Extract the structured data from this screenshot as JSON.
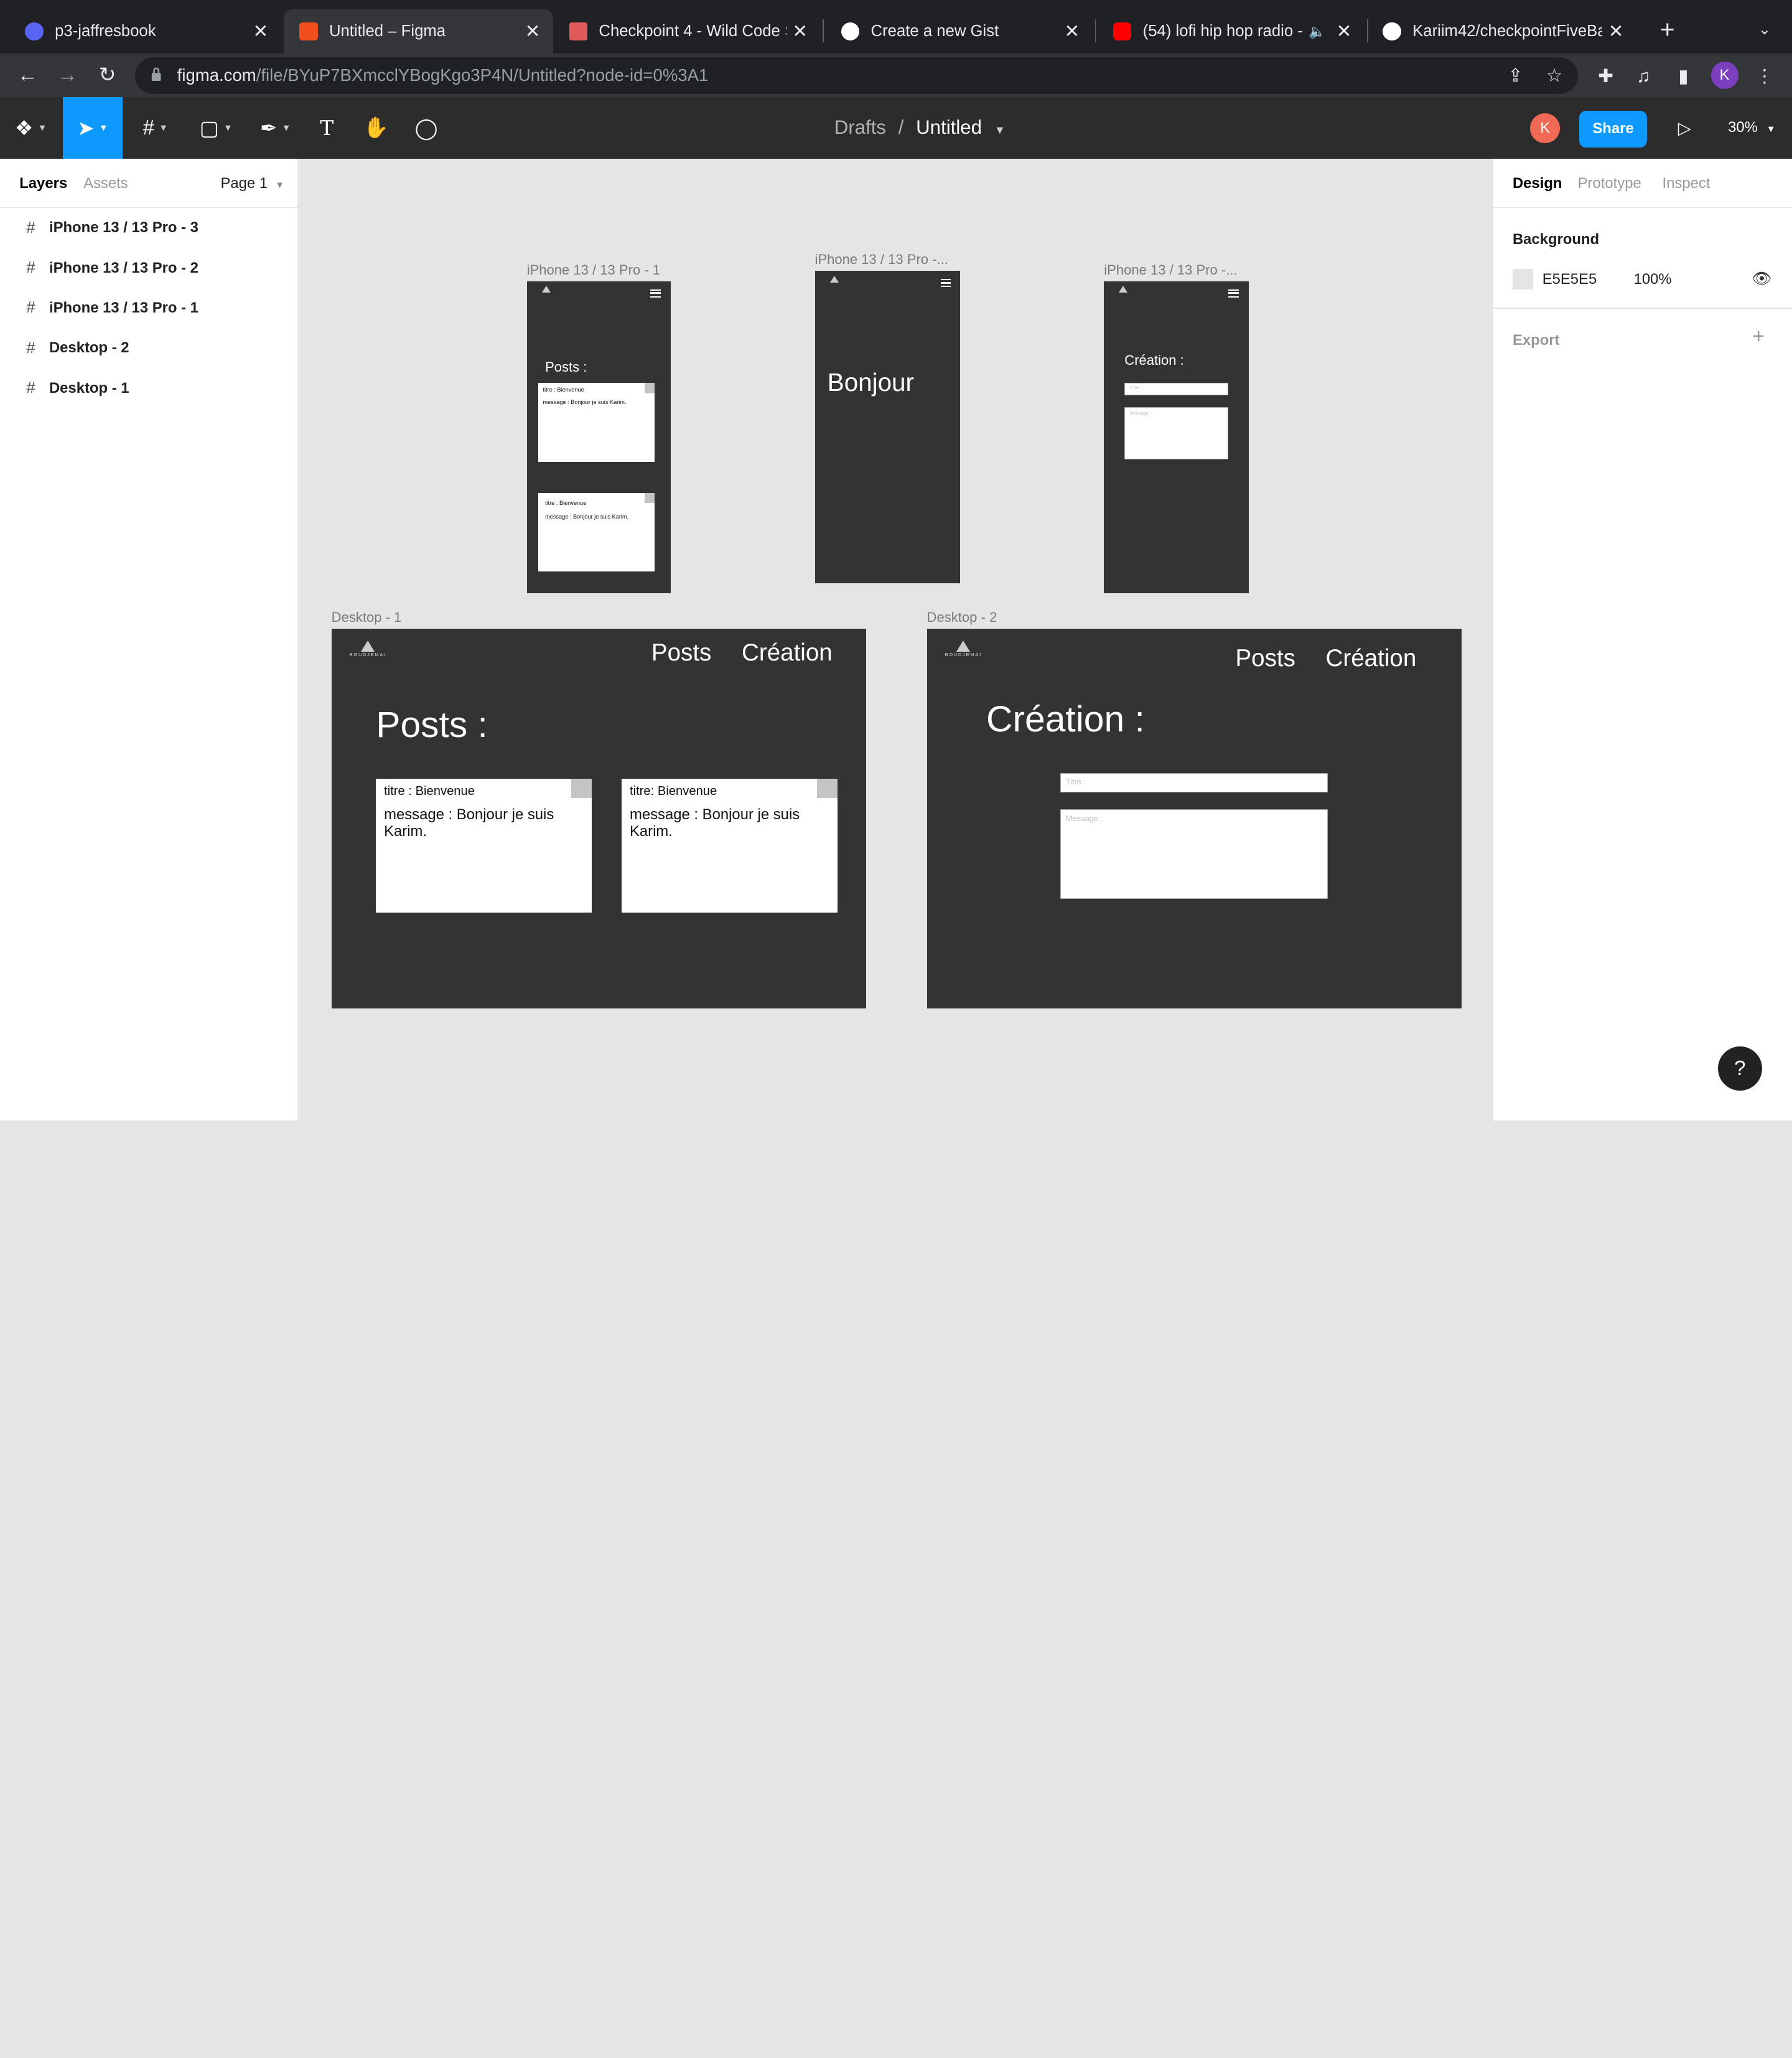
{
  "browser": {
    "tabs": [
      {
        "title": "p3-jaffresbook",
        "icon": "discord-icon",
        "color": "#5865f2"
      },
      {
        "title": "Untitled – Figma",
        "icon": "figma-icon",
        "color": "#f24e1e"
      },
      {
        "title": "Checkpoint 4 - Wild Code S",
        "icon": "wildcode-icon",
        "color": "#e05a5a"
      },
      {
        "title": "Create a new Gist",
        "icon": "github-icon",
        "color": "#ffffff"
      },
      {
        "title": "(54) lofi hip hop radio -",
        "icon": "youtube-icon",
        "color": "#ff0000"
      },
      {
        "title": "Kariim42/checkpointFiveBa",
        "icon": "github-icon",
        "color": "#ffffff"
      }
    ],
    "url_host": "figma.com",
    "url_path": "/file/BYuP7BXmcclYBogKgo3P4N/Untitled?node-id=0%3A1",
    "profile_initial": "K"
  },
  "figma": {
    "breadcrumb_root": "Drafts",
    "breadcrumb_sep": "/",
    "file_name": "Untitled",
    "avatar_initial": "K",
    "share_label": "Share",
    "zoom": "30%"
  },
  "left_panel": {
    "tab_layers": "Layers",
    "tab_assets": "Assets",
    "page": "Page 1",
    "layers": [
      "iPhone 13 / 13 Pro - 3",
      "iPhone 13 / 13 Pro - 2",
      "iPhone 13 / 13 Pro - 1",
      "Desktop - 2",
      "Desktop - 1"
    ]
  },
  "right_panel": {
    "tab_design": "Design",
    "tab_prototype": "Prototype",
    "tab_inspect": "Inspect",
    "background_title": "Background",
    "background_hex": "E5E5E5",
    "background_opacity": "100%",
    "export_title": "Export",
    "background_color": "#e5e5e5"
  },
  "canvas": {
    "labels": {
      "iphone1": "iPhone 13 / 13 Pro - 1",
      "iphone2": "iPhone 13 / 13 Pro -...",
      "iphone3": "iPhone 13 / 13 Pro -...",
      "desktop1": "Desktop - 1",
      "desktop2": "Desktop - 2"
    },
    "logo_text": "BOUDJEMAI",
    "mobile_posts_title": "Posts :",
    "mobile_bonjour": "Bonjour",
    "mobile_creation_title": "Création :",
    "card_title": "titre :  Bienvenue",
    "card_message": "message : Bonjour je suis Karim.",
    "desk_card_title_1": "titre :  Bienvenue",
    "desk_card_title_2": "titre:  Bienvenue",
    "desk_card_message": "message : Bonjour je suis Karim.",
    "nav_posts": "Posts",
    "nav_creation": "Création",
    "desk_posts_title": "Posts :",
    "desk_creation_title": "Création :",
    "field_titre": "Titre :",
    "field_message": "Message :"
  },
  "help": "?"
}
